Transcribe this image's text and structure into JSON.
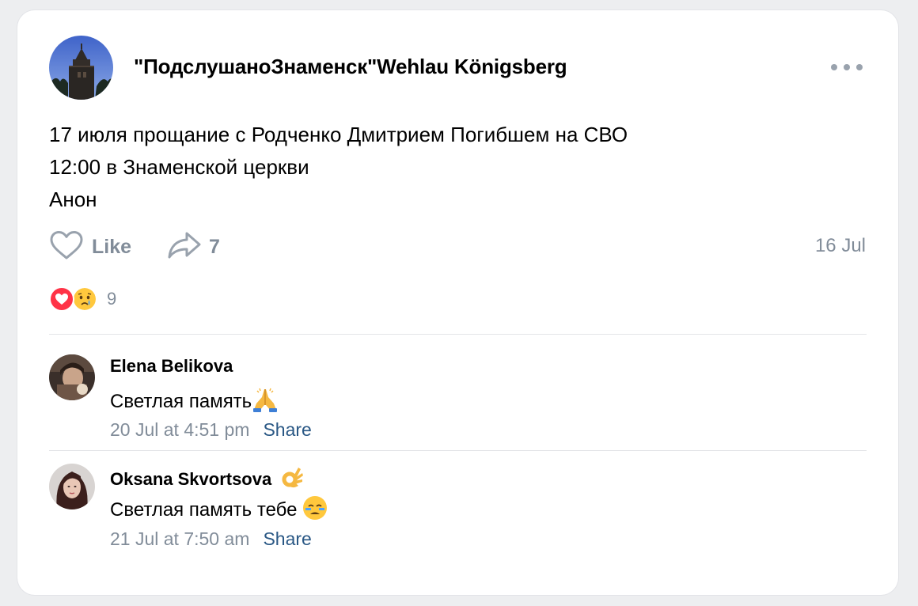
{
  "post": {
    "group_name": "\"ПодслушаноЗнаменск\"Wehlau Königsberg",
    "text_lines": [
      "17 июля прощание с Родченко Дмитрием Погибшем на СВО",
      "12:00 в Знаменской церкви",
      "Анон"
    ],
    "like_label": "Like",
    "share_count": "7",
    "date": "16 Jul",
    "reaction_count": "9",
    "reactions": [
      "heart-icon",
      "crying-face-icon"
    ]
  },
  "comments": [
    {
      "author": "Elena Belikova",
      "text": "Светлая память",
      "emoji": "praying-hands-icon",
      "date": "20 Jul at 4:51 pm",
      "share_label": "Share"
    },
    {
      "author": "Oksana Skvortsova",
      "author_emoji": "ok-hand-icon",
      "text": "Светлая память тебе",
      "emoji": "tearful-face-icon",
      "date": "21 Jul at 7:50 am",
      "share_label": "Share"
    }
  ],
  "colors": {
    "background": "#edeef0",
    "card": "#ffffff",
    "secondary_text": "#818c99",
    "link": "#2a5885",
    "heart": "#ff3347"
  }
}
